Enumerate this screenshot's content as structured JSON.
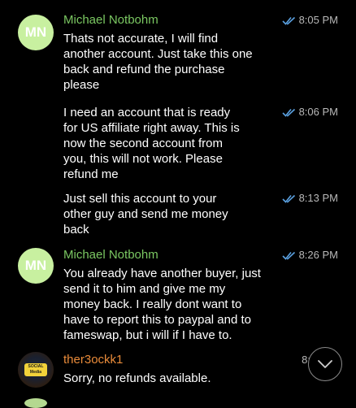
{
  "colors": {
    "background": "#000000",
    "sender_mn": "#7bc862",
    "sender_ther": "#e98b3a",
    "check": "#5aa0e0",
    "avatar_mn": "#c8f0a0"
  },
  "messages": [
    {
      "avatar": "MN",
      "sender": "Michael Notbohm",
      "text": "Thats not accurate, I will find\nanother account.  Just take this one\nback and refund the purchase\nplease",
      "time": "8:05 PM",
      "status_icon": "double-check-icon"
    },
    {
      "text": "I need an account that is ready\nfor US affiliate right away.  This is\nnow the second account from\nyou, this will not work.  Please\nrefund me",
      "time": "8:06 PM",
      "status_icon": "double-check-icon"
    },
    {
      "text": "Just sell this account to your\nother guy and send me money\nback",
      "time": "8:13 PM",
      "status_icon": "double-check-icon"
    },
    {
      "avatar": "MN",
      "sender": "Michael Notbohm",
      "text": "You already have another buyer, just\nsend it to him and give me my\nmoney back.  I really dont want to\nhave to report this to paypal and to\nfameswap, but i will if I have to.",
      "time": "8:26 PM",
      "status_icon": "double-check-icon"
    },
    {
      "avatar_logo_text": "SOCIAL Media",
      "sender": "ther3ockk1",
      "text": "Sorry, no refunds available.",
      "time": "8:"
    }
  ],
  "scroll_button": {
    "icon": "chevron-down-icon"
  }
}
